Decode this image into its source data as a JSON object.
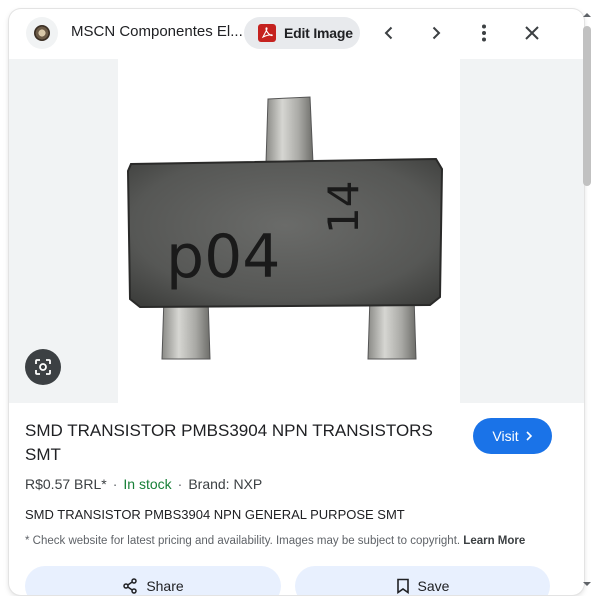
{
  "header": {
    "site_title": "MSCN Componentes El...",
    "edit_button_label": "Edit Image",
    "icons": [
      "favicon",
      "pdf-icon",
      "chevron-left-icon",
      "chevron-right-icon",
      "more-vert-icon",
      "close-icon"
    ]
  },
  "image": {
    "component_marking_main": "p04",
    "component_marking_side": "14",
    "lens_icon": "google-lens-icon"
  },
  "product": {
    "title": "SMD TRANSISTOR PMBS3904 NPN TRANSISTORS SMT",
    "visit_label": "Visit",
    "price": "R$0.57 BRL*",
    "stock": "In stock",
    "brand": "Brand: NXP",
    "description": "SMD TRANSISTOR PMBS3904 NPN GENERAL PURPOSE SMT",
    "disclaimer": "* Check website for latest pricing and availability. Images may be subject to copyright.",
    "learn_more": "Learn More"
  },
  "actions": {
    "share_label": "Share",
    "save_label": "Save"
  },
  "colors": {
    "accent": "#1a73e8",
    "in_stock": "#188038",
    "pdf_red": "#c5221f",
    "button_bg": "#e8f0fe"
  }
}
